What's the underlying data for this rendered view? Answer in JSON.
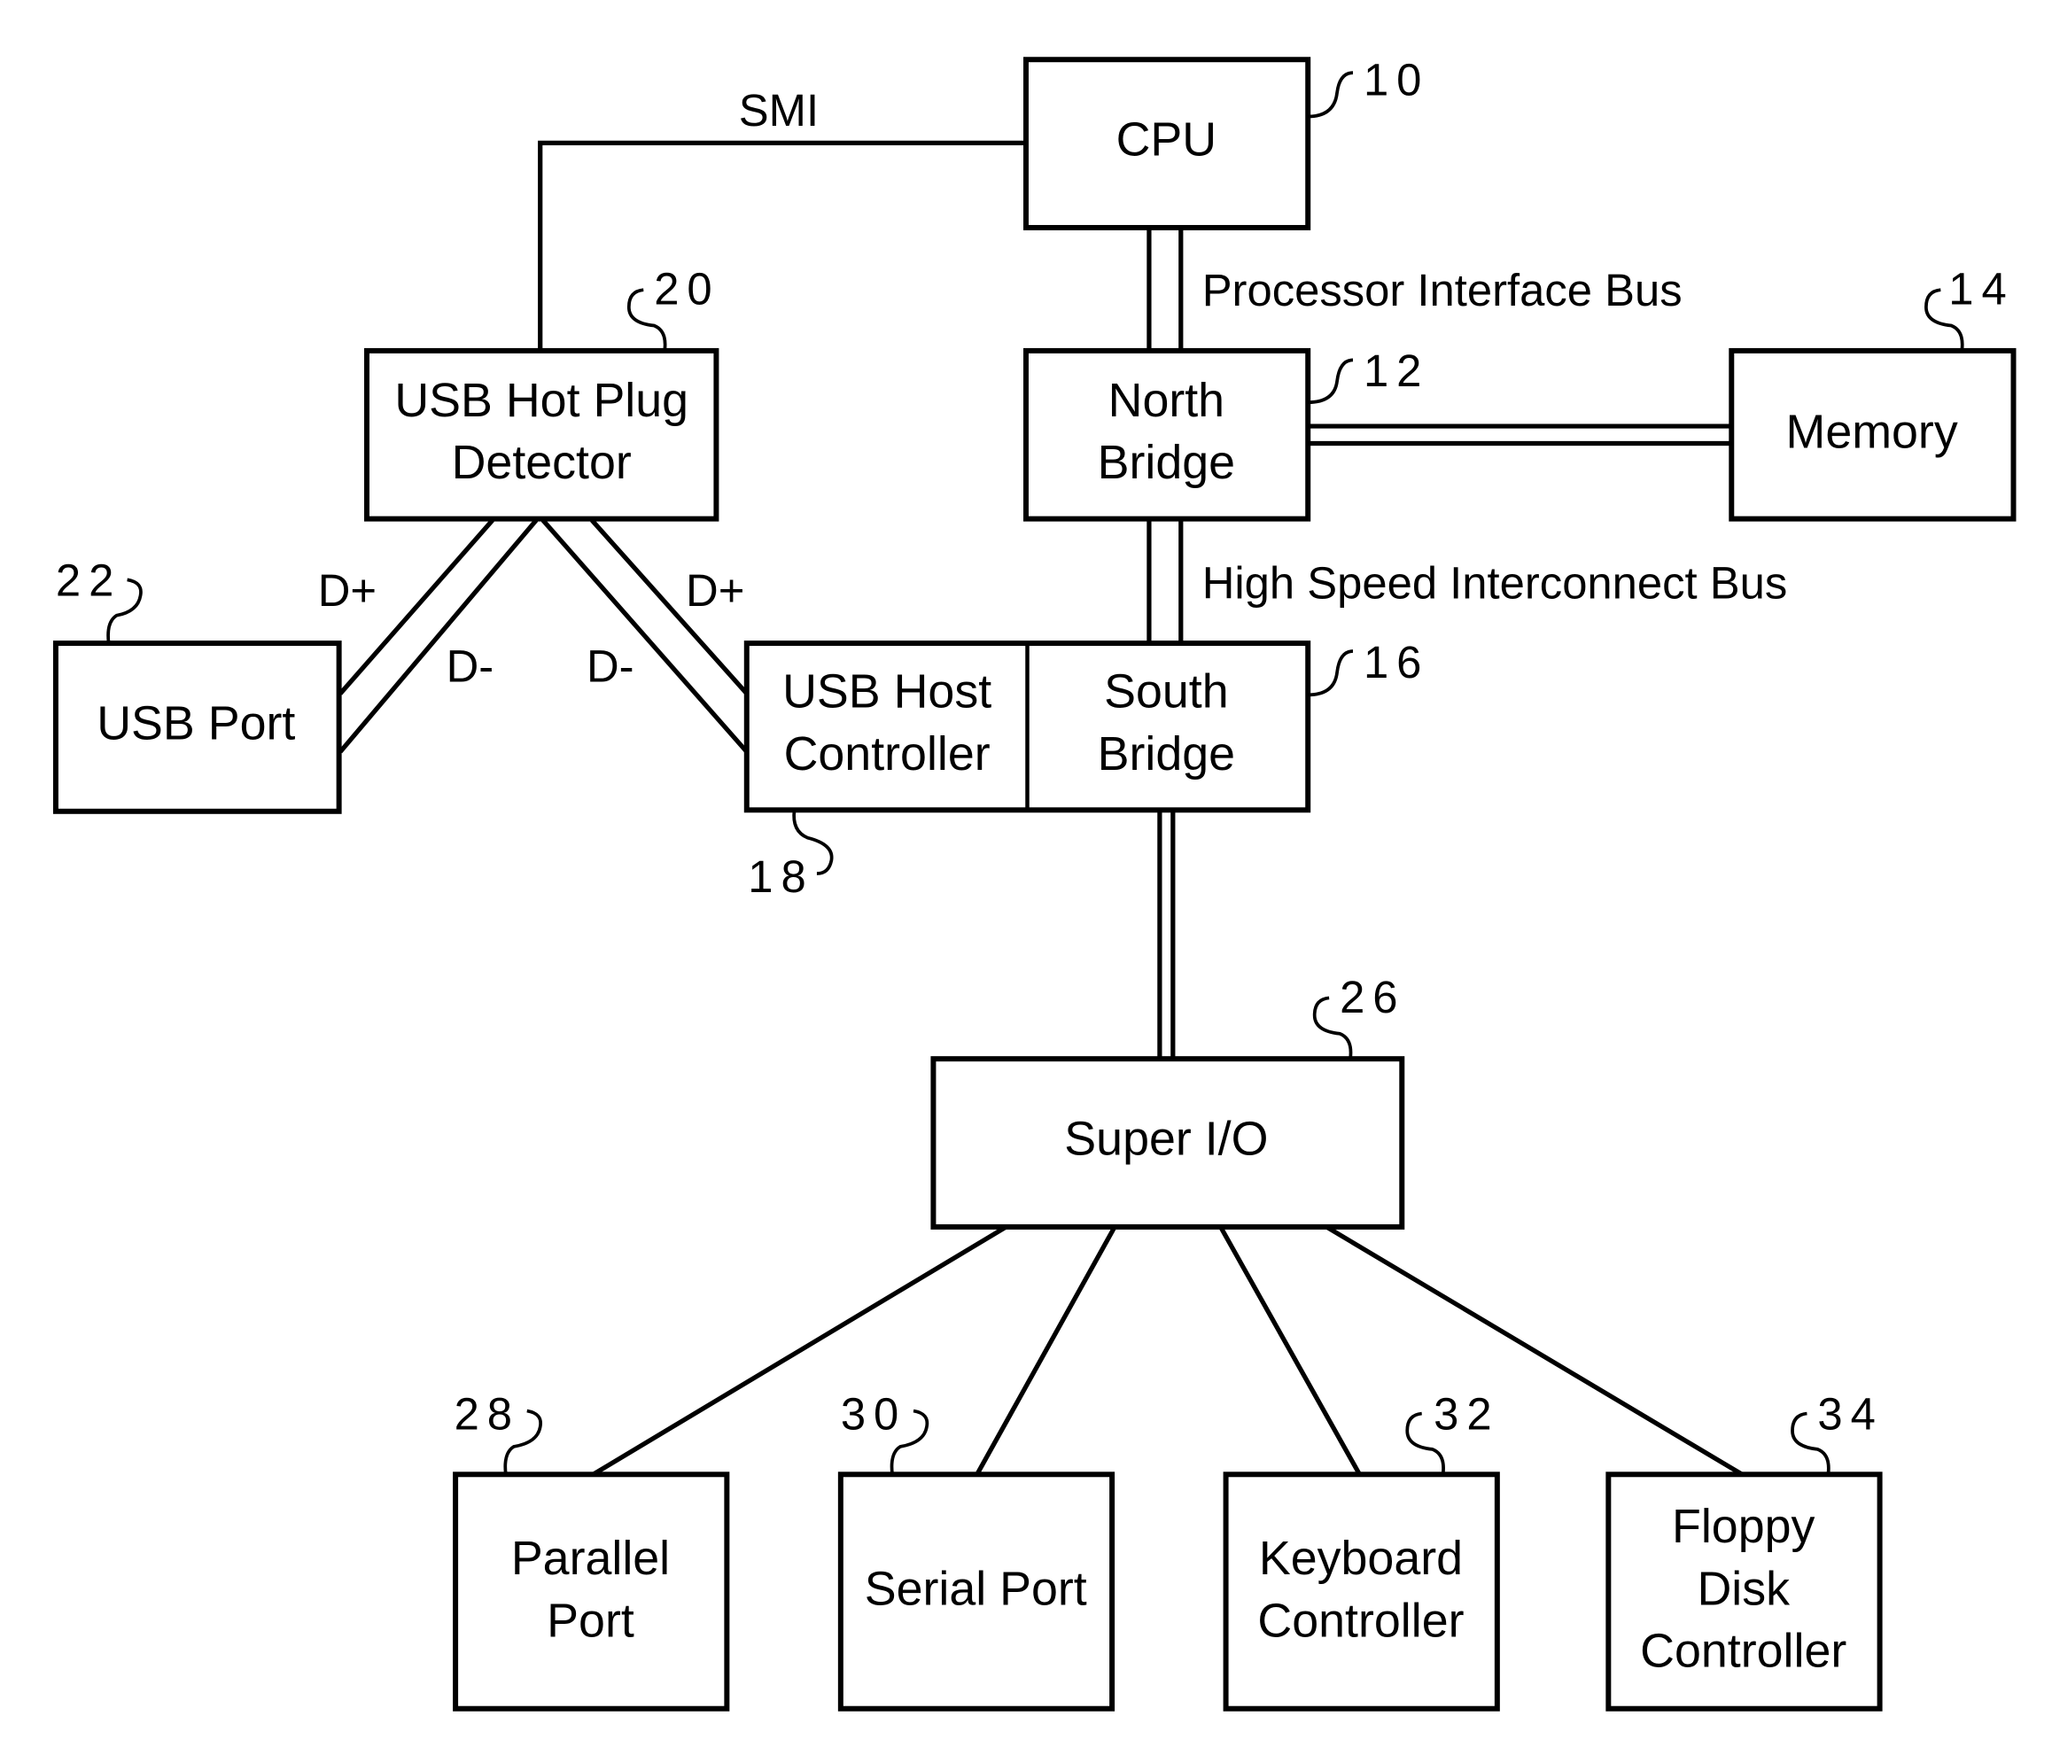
{
  "figure": {
    "nodes": {
      "cpu": {
        "label": [
          "CPU"
        ],
        "ref": "10"
      },
      "north_bridge": {
        "label": [
          "North",
          "Bridge"
        ],
        "ref": "12"
      },
      "memory": {
        "label": [
          "Memory"
        ],
        "ref": "14"
      },
      "south_bridge": {
        "label": [
          "South",
          "Bridge"
        ],
        "ref": "16"
      },
      "usb_host_controller": {
        "label": [
          "USB Host",
          "Controller"
        ],
        "ref": "18"
      },
      "usb_hot_plug_detector": {
        "label": [
          "USB Hot Plug",
          "Detector"
        ],
        "ref": "20"
      },
      "usb_port": {
        "label": [
          "USB Port"
        ],
        "ref": "22"
      },
      "super_io": {
        "label": [
          "Super I/O"
        ],
        "ref": "26"
      },
      "parallel_port": {
        "label": [
          "Parallel",
          "Port"
        ],
        "ref": "28"
      },
      "serial_port": {
        "label": [
          "Serial Port"
        ],
        "ref": "30"
      },
      "keyboard_controller": {
        "label": [
          "Keyboard",
          "Controller"
        ],
        "ref": "32"
      },
      "floppy_disk_controller": {
        "label": [
          "Floppy",
          "Disk",
          "Controller"
        ],
        "ref": "34"
      }
    },
    "connections": {
      "smi": "SMI",
      "processor_interface_bus": "Processor Interface Bus",
      "high_speed_interconnect_bus": "High Speed Interconnect Bus",
      "d_plus_port": "D+",
      "d_minus_port": "D-",
      "d_plus_host": "D+",
      "d_minus_host": "D-"
    },
    "edges": [
      {
        "from": "usb_hot_plug_detector",
        "to": "cpu",
        "label": "SMI"
      },
      {
        "from": "cpu",
        "to": "north_bridge",
        "label": "Processor Interface Bus",
        "type": "bus"
      },
      {
        "from": "north_bridge",
        "to": "memory",
        "type": "bus"
      },
      {
        "from": "north_bridge",
        "to": "south_bridge",
        "label": "High Speed Interconnect Bus",
        "type": "bus"
      },
      {
        "from": "usb_hot_plug_detector",
        "to": "usb_port",
        "label": "D+ / D-"
      },
      {
        "from": "usb_hot_plug_detector",
        "to": "usb_host_controller",
        "label": "D+ / D-"
      },
      {
        "from": "south_bridge",
        "to": "super_io",
        "type": "bus"
      },
      {
        "from": "super_io",
        "to": "parallel_port"
      },
      {
        "from": "super_io",
        "to": "serial_port"
      },
      {
        "from": "super_io",
        "to": "keyboard_controller"
      },
      {
        "from": "super_io",
        "to": "floppy_disk_controller"
      }
    ]
  }
}
